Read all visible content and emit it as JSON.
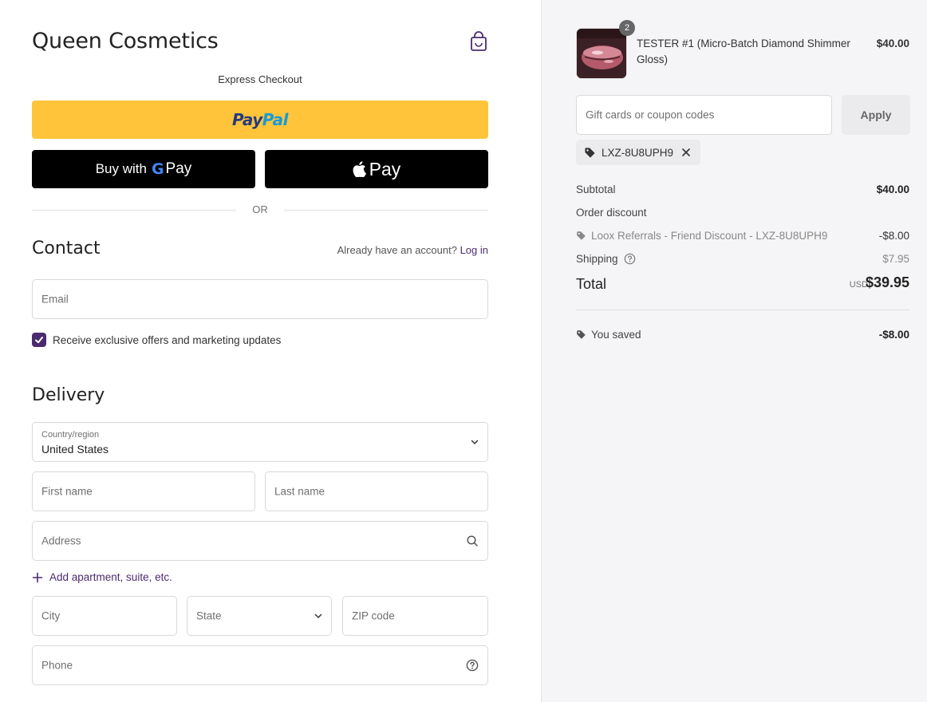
{
  "store": {
    "name": "Queen Cosmetics",
    "cart_icon": "shopping-bag-icon"
  },
  "express": {
    "label": "Express Checkout",
    "paypal": {
      "part1": "Pay",
      "part2": "Pal"
    },
    "google_pay": {
      "prefix": "Buy with",
      "g": "G",
      "pay": "Pay"
    },
    "apple_pay": {
      "pay": "Pay"
    },
    "divider": "OR"
  },
  "contact": {
    "title": "Contact",
    "account_prompt": "Already have an account?",
    "login_link": "Log in",
    "email_placeholder": "Email",
    "marketing_checkbox": {
      "label": "Receive exclusive offers and marketing updates",
      "checked": true
    }
  },
  "delivery": {
    "title": "Delivery",
    "country_label": "Country/region",
    "country_value": "United States",
    "first_name_placeholder": "First name",
    "last_name_placeholder": "Last name",
    "address_placeholder": "Address",
    "add_apartment": "Add apartment, suite, etc.",
    "city_placeholder": "City",
    "state_placeholder": "State",
    "zip_placeholder": "ZIP code",
    "phone_placeholder": "Phone"
  },
  "order": {
    "item": {
      "name": "TESTER #1 (Micro-Batch Diamond Shimmer Gloss)",
      "quantity": "2",
      "price": "$40.00"
    },
    "coupon_placeholder": "Gift cards or coupon codes",
    "apply_label": "Apply",
    "applied_code": "LXZ-8U8UPH9",
    "subtotal_label": "Subtotal",
    "subtotal_value": "$40.00",
    "order_discount_label": "Order discount",
    "discount_detail": "Loox Referrals - Friend Discount - LXZ-8U8UPH9",
    "discount_value": "-$8.00",
    "shipping_label": "Shipping",
    "shipping_value": "$7.95",
    "total_label": "Total",
    "currency": "USD",
    "total_value": "$39.95",
    "saved_label": "You saved",
    "saved_value": "-$8.00"
  },
  "colors": {
    "accent": "#4a2b6e",
    "paypal_yellow": "#ffc439",
    "summary_bg": "#f5f5f7"
  }
}
